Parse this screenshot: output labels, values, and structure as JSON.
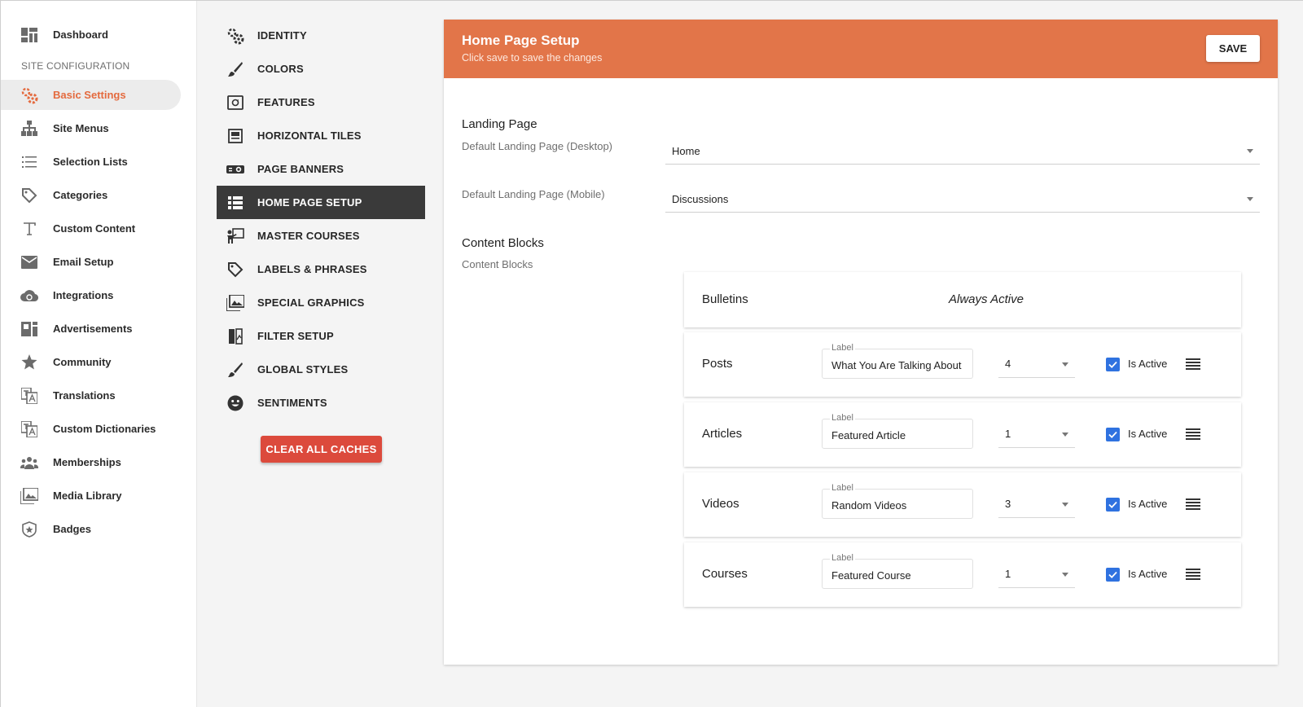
{
  "sidebar": {
    "section_header": "SITE CONFIGURATION",
    "items": [
      {
        "label": "Dashboard",
        "icon": "dashboard-icon"
      },
      {
        "label": "Basic Settings",
        "icon": "gears-icon",
        "active": true
      },
      {
        "label": "Site Menus",
        "icon": "sitemap-icon"
      },
      {
        "label": "Selection Lists",
        "icon": "list-icon"
      },
      {
        "label": "Categories",
        "icon": "tag-icon"
      },
      {
        "label": "Custom Content",
        "icon": "text-icon"
      },
      {
        "label": "Email Setup",
        "icon": "mail-icon"
      },
      {
        "label": "Integrations",
        "icon": "cloud-sync-icon"
      },
      {
        "label": "Advertisements",
        "icon": "ad-icon"
      },
      {
        "label": "Community",
        "icon": "star-icon"
      },
      {
        "label": "Translations",
        "icon": "translate-icon"
      },
      {
        "label": "Custom Dictionaries",
        "icon": "translate-icon"
      },
      {
        "label": "Memberships",
        "icon": "group-icon"
      },
      {
        "label": "Media Library",
        "icon": "photo-library-icon"
      },
      {
        "label": "Badges",
        "icon": "badge-icon"
      }
    ]
  },
  "settings_menu": {
    "items": [
      {
        "label": "IDENTITY",
        "icon": "gears-icon"
      },
      {
        "label": "COLORS",
        "icon": "brush-icon"
      },
      {
        "label": "FEATURES",
        "icon": "features-icon"
      },
      {
        "label": "HORIZONTAL TILES",
        "icon": "tiles-icon"
      },
      {
        "label": "PAGE BANNERS",
        "icon": "projector-icon"
      },
      {
        "label": "HOME PAGE SETUP",
        "icon": "list-view-icon",
        "active": true
      },
      {
        "label": "MASTER COURSES",
        "icon": "presenter-icon"
      },
      {
        "label": "LABELS & PHRASES",
        "icon": "tag-icon"
      },
      {
        "label": "SPECIAL GRAPHICS",
        "icon": "photo-library-icon"
      },
      {
        "label": "FILTER SETUP",
        "icon": "filter-setup-icon"
      },
      {
        "label": "GLOBAL STYLES",
        "icon": "brush-icon"
      },
      {
        "label": "SENTIMENTS",
        "icon": "smiley-icon"
      }
    ],
    "clear_button": "CLEAR ALL CACHES"
  },
  "header": {
    "title": "Home Page Setup",
    "subtitle": "Click save to save the changes",
    "save_label": "SAVE",
    "accent_color": "#e27549"
  },
  "landing": {
    "title": "Landing Page",
    "desktop_label": "Default Landing Page (Desktop)",
    "desktop_value": "Home",
    "mobile_label": "Default Landing Page (Mobile)",
    "mobile_value": "Discussions"
  },
  "content_blocks": {
    "title": "Content Blocks",
    "subtitle": "Content Blocks",
    "bulletins": {
      "name": "Bulletins",
      "status": "Always Active"
    },
    "label_caption": "Label",
    "active_label": "Is Active",
    "rows": [
      {
        "name": "Posts",
        "label": "What You Are Talking About",
        "count": "4",
        "active": true
      },
      {
        "name": "Articles",
        "label": "Featured Article",
        "count": "1",
        "active": true
      },
      {
        "name": "Videos",
        "label": "Random Videos",
        "count": "3",
        "active": true
      },
      {
        "name": "Courses",
        "label": "Featured Course",
        "count": "1",
        "active": true
      }
    ]
  }
}
